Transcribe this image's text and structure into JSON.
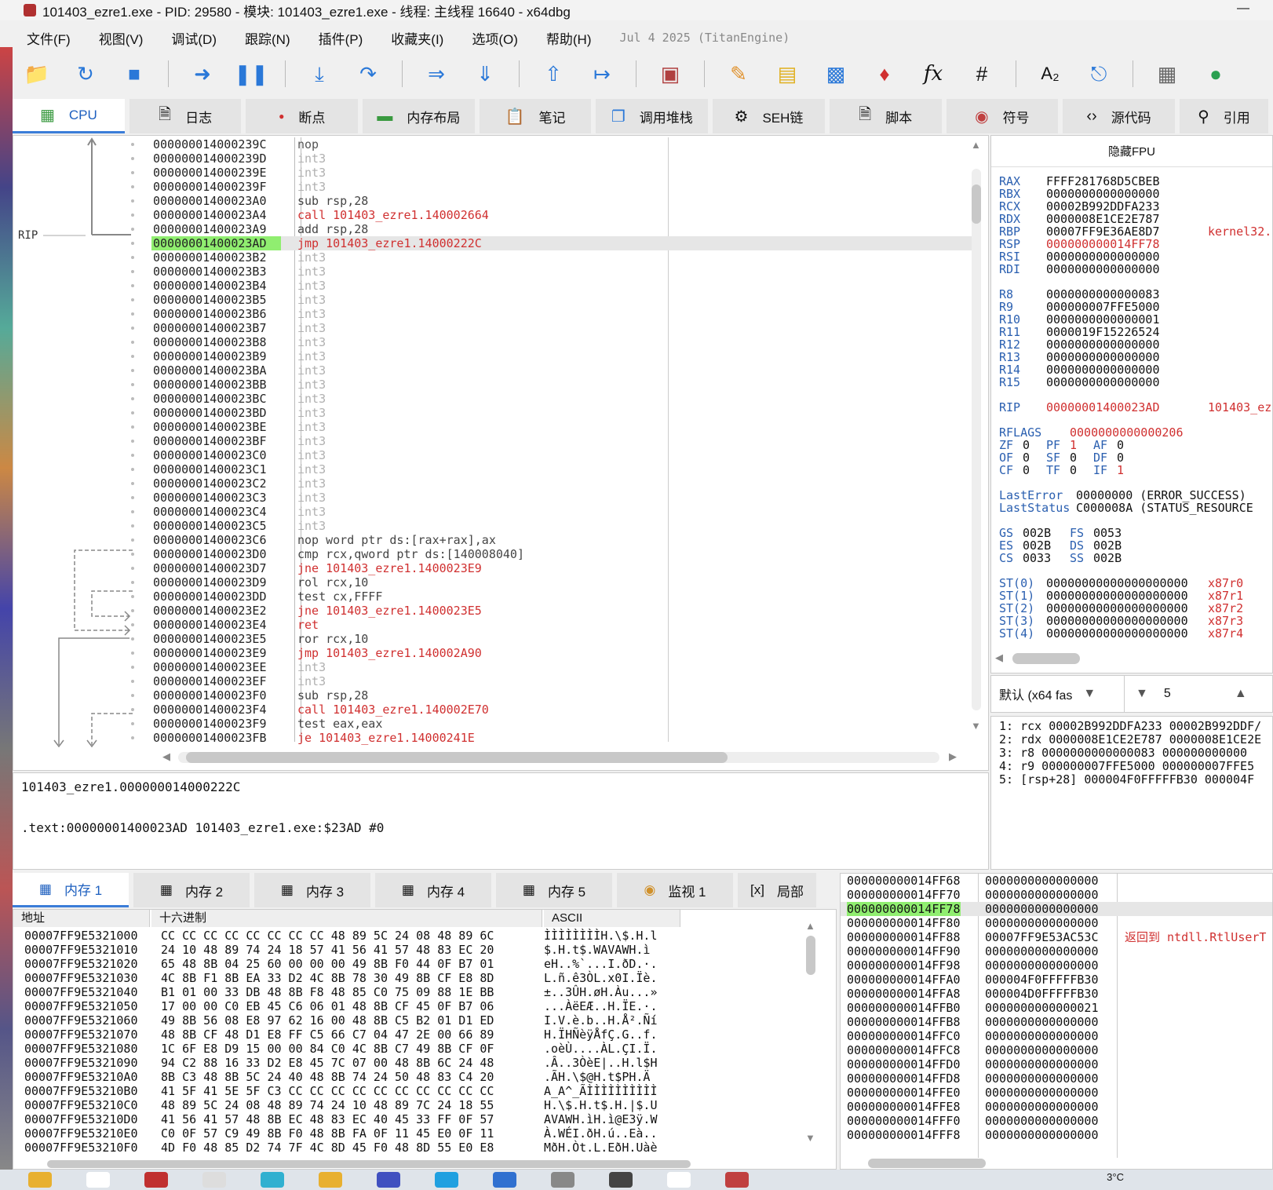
{
  "window": {
    "title": "101403_ezre1.exe - PID: 29580 - 模块: 101403_ezre1.exe - 线程: 主线程 16640 - x64dbg",
    "minimize": "—"
  },
  "menu": {
    "items": [
      "文件(F)",
      "视图(V)",
      "调试(D)",
      "跟踪(N)",
      "插件(P)",
      "收藏夹(I)",
      "选项(O)",
      "帮助(H)"
    ],
    "date": "Jul 4 2025 (TitanEngine)"
  },
  "toolbar": {
    "icons": [
      "open-icon",
      "restart-icon",
      "stop-icon",
      "run-icon",
      "pause-icon",
      "step-into-icon",
      "step-over-icon",
      "trace-into-icon",
      "trace-over-icon",
      "run-to-user-icon",
      "execute-till-return-icon",
      "script-icon",
      "patch-icon",
      "comment-icon",
      "label-icon",
      "bookmark-icon",
      "function-icon",
      "hash-icon",
      "font-icon",
      "find-icon",
      "calculator-icon",
      "globe-icon"
    ],
    "fx": "fx",
    "hash": "#",
    "az": "A₂"
  },
  "tabs": [
    {
      "label": "CPU"
    },
    {
      "label": "日志"
    },
    {
      "label": "断点"
    },
    {
      "label": "内存布局"
    },
    {
      "label": "笔记"
    },
    {
      "label": "调用堆栈"
    },
    {
      "label": "SEH链"
    },
    {
      "label": "脚本"
    },
    {
      "label": "符号"
    },
    {
      "label": "源代码"
    },
    {
      "label": "引用"
    }
  ],
  "disasm": {
    "rip_label": "RIP",
    "rows": [
      {
        "addr": "000000014000239C",
        "ins": "nop",
        "cls": "c-nop"
      },
      {
        "addr": "000000014000239D",
        "ins": "int3",
        "cls": "c-int"
      },
      {
        "addr": "000000014000239E",
        "ins": "int3",
        "cls": "c-int"
      },
      {
        "addr": "000000014000239F",
        "ins": "int3",
        "cls": "c-int"
      },
      {
        "addr": "00000001400023A0",
        "ins": "sub rsp,28",
        "cls": "c-op"
      },
      {
        "addr": "00000001400023A4",
        "ins": "call 101403_ezre1.140002664",
        "cls": "c-call"
      },
      {
        "addr": "00000001400023A9",
        "ins": "add rsp,28",
        "cls": "c-op"
      },
      {
        "addr": "00000001400023AD",
        "ins": "jmp 101403_ezre1.14000222C",
        "cls": "c-jmp",
        "rip": true
      },
      {
        "addr": "00000001400023B2",
        "ins": "int3",
        "cls": "c-int"
      },
      {
        "addr": "00000001400023B3",
        "ins": "int3",
        "cls": "c-int"
      },
      {
        "addr": "00000001400023B4",
        "ins": "int3",
        "cls": "c-int"
      },
      {
        "addr": "00000001400023B5",
        "ins": "int3",
        "cls": "c-int"
      },
      {
        "addr": "00000001400023B6",
        "ins": "int3",
        "cls": "c-int"
      },
      {
        "addr": "00000001400023B7",
        "ins": "int3",
        "cls": "c-int"
      },
      {
        "addr": "00000001400023B8",
        "ins": "int3",
        "cls": "c-int"
      },
      {
        "addr": "00000001400023B9",
        "ins": "int3",
        "cls": "c-int"
      },
      {
        "addr": "00000001400023BA",
        "ins": "int3",
        "cls": "c-int"
      },
      {
        "addr": "00000001400023BB",
        "ins": "int3",
        "cls": "c-int"
      },
      {
        "addr": "00000001400023BC",
        "ins": "int3",
        "cls": "c-int"
      },
      {
        "addr": "00000001400023BD",
        "ins": "int3",
        "cls": "c-int"
      },
      {
        "addr": "00000001400023BE",
        "ins": "int3",
        "cls": "c-int"
      },
      {
        "addr": "00000001400023BF",
        "ins": "int3",
        "cls": "c-int"
      },
      {
        "addr": "00000001400023C0",
        "ins": "int3",
        "cls": "c-int"
      },
      {
        "addr": "00000001400023C1",
        "ins": "int3",
        "cls": "c-int"
      },
      {
        "addr": "00000001400023C2",
        "ins": "int3",
        "cls": "c-int"
      },
      {
        "addr": "00000001400023C3",
        "ins": "int3",
        "cls": "c-int"
      },
      {
        "addr": "00000001400023C4",
        "ins": "int3",
        "cls": "c-int"
      },
      {
        "addr": "00000001400023C5",
        "ins": "int3",
        "cls": "c-int"
      },
      {
        "addr": "00000001400023C6",
        "ins": "nop word ptr ds:[rax+rax],ax",
        "cls": "c-op"
      },
      {
        "addr": "00000001400023D0",
        "ins": "cmp rcx,qword ptr ds:[140008040]",
        "cls": "c-op"
      },
      {
        "addr": "00000001400023D7",
        "ins": "jne 101403_ezre1.1400023E9",
        "cls": "c-jmp"
      },
      {
        "addr": "00000001400023D9",
        "ins": "rol rcx,10",
        "cls": "c-op"
      },
      {
        "addr": "00000001400023DD",
        "ins": "test cx,FFFF",
        "cls": "c-op"
      },
      {
        "addr": "00000001400023E2",
        "ins": "jne 101403_ezre1.1400023E5",
        "cls": "c-jmp"
      },
      {
        "addr": "00000001400023E4",
        "ins": "ret",
        "cls": "c-ret"
      },
      {
        "addr": "00000001400023E5",
        "ins": "ror rcx,10",
        "cls": "c-op"
      },
      {
        "addr": "00000001400023E9",
        "ins": "jmp 101403_ezre1.140002A90",
        "cls": "c-jmp"
      },
      {
        "addr": "00000001400023EE",
        "ins": "int3",
        "cls": "c-int"
      },
      {
        "addr": "00000001400023EF",
        "ins": "int3",
        "cls": "c-int"
      },
      {
        "addr": "00000001400023F0",
        "ins": "sub rsp,28",
        "cls": "c-op"
      },
      {
        "addr": "00000001400023F4",
        "ins": "call 101403_ezre1.140002E70",
        "cls": "c-call"
      },
      {
        "addr": "00000001400023F9",
        "ins": "test eax,eax",
        "cls": "c-op"
      },
      {
        "addr": "00000001400023FB",
        "ins": "je 101403_ezre1.14000241E",
        "cls": "c-jmp"
      }
    ]
  },
  "info": {
    "line1": "101403_ezre1.000000014000222C",
    "line2": ".text:00000001400023AD 101403_ezre1.exe:$23AD #0"
  },
  "registers": {
    "header": "隐藏FPU",
    "rows": [
      {
        "n": "RAX",
        "v": "FFFF281768D5CBEB"
      },
      {
        "n": "RBX",
        "v": "0000000000000000"
      },
      {
        "n": "RCX",
        "v": "00002B992DDFA233"
      },
      {
        "n": "RDX",
        "v": "0000008E1CE2E787"
      },
      {
        "n": "RBP",
        "v": "00007FF9E36AE8D7",
        "c": "kernel32."
      },
      {
        "n": "RSP",
        "v": "000000000014FF78",
        "red": true
      },
      {
        "n": "RSI",
        "v": "0000000000000000"
      },
      {
        "n": "RDI",
        "v": "0000000000000000"
      },
      {
        "n": "",
        "v": ""
      },
      {
        "n": "R8",
        "v": "0000000000000083"
      },
      {
        "n": "R9",
        "v": "000000007FFE5000"
      },
      {
        "n": "R10",
        "v": "0000000000000001"
      },
      {
        "n": "R11",
        "v": "0000019F15226524"
      },
      {
        "n": "R12",
        "v": "0000000000000000"
      },
      {
        "n": "R13",
        "v": "0000000000000000"
      },
      {
        "n": "R14",
        "v": "0000000000000000"
      },
      {
        "n": "R15",
        "v": "0000000000000000"
      },
      {
        "n": "",
        "v": ""
      },
      {
        "n": "RIP",
        "v": "00000001400023AD",
        "red": true,
        "c": "101403_ez"
      },
      {
        "n": "",
        "v": ""
      }
    ],
    "rflags_label": "RFLAGS",
    "rflags": "0000000000000206",
    "flags": [
      [
        "ZF",
        "0",
        "PF",
        "1",
        "AF",
        "0"
      ],
      [
        "OF",
        "0",
        "SF",
        "0",
        "DF",
        "0"
      ],
      [
        "CF",
        "0",
        "TF",
        "0",
        "IF",
        "1"
      ]
    ],
    "last": [
      [
        "LastError",
        "00000000 (ERROR_SUCCESS)"
      ],
      [
        "LastStatus",
        "C000008A (STATUS_RESOURCE"
      ]
    ],
    "seg": [
      [
        "GS",
        "002B",
        "FS",
        "0053"
      ],
      [
        "ES",
        "002B",
        "DS",
        "002B"
      ],
      [
        "CS",
        "0033",
        "SS",
        "002B"
      ]
    ],
    "st": [
      [
        "ST(0)",
        "00000000000000000000",
        "x87r0"
      ],
      [
        "ST(1)",
        "00000000000000000000",
        "x87r1"
      ],
      [
        "ST(2)",
        "00000000000000000000",
        "x87r2"
      ],
      [
        "ST(3)",
        "00000000000000000000",
        "x87r3"
      ],
      [
        "ST(4)",
        "00000000000000000000",
        "x87r4"
      ]
    ]
  },
  "callconv": {
    "selected": "默认 (x64 fas",
    "count": "5"
  },
  "args": [
    "1: rcx 00002B992DDFA233 00002B992DDF/",
    "2: rdx 0000008E1CE2E787 0000008E1CE2E",
    "3: r8 0000000000000083 000000000000",
    "4: r9 000000007FFE5000 000000007FFE5",
    "5: [rsp+28] 000004F0FFFFFB30 000004F"
  ],
  "memtabs": [
    {
      "label": "内存 1"
    },
    {
      "label": "内存 2"
    },
    {
      "label": "内存 3"
    },
    {
      "label": "内存 4"
    },
    {
      "label": "内存 5"
    },
    {
      "label": "监视 1"
    },
    {
      "label": "局部"
    }
  ],
  "dump": {
    "hdr_addr": "地址",
    "hdr_hex": "十六进制",
    "hdr_ascii": "ASCII",
    "rows": [
      {
        "a": "00007FF9E5321000",
        "h": "CC CC CC CC CC CC CC CC 48 89 5C 24 08 48 89 6C",
        "s": "ÌÌÌÌÌÌÌÌH.\\$.H.l"
      },
      {
        "a": "00007FF9E5321010",
        "h": "24 10 48 89 74 24 18 57 41 56 41 57 48 83 EC 20",
        "s": "$.H.t$.WAVAWH.ì "
      },
      {
        "a": "00007FF9E5321020",
        "h": "65 48 8B 04 25 60 00 00 00 49 8B F0 44 0F B7 01",
        "s": "eH..%`...I.ðD.·."
      },
      {
        "a": "00007FF9E5321030",
        "h": "4C 8B F1 8B EA 33 D2 4C 8B 78 30 49 8B CF E8 8D",
        "s": "L.ñ.ê3ÒL.x0I.Ïè."
      },
      {
        "a": "00007FF9E5321040",
        "h": "B1 01 00 33 DB 48 8B F8 48 85 C0 75 09 88 1E BB",
        "s": "±..3ÛH.øH.Àu...»"
      },
      {
        "a": "00007FF9E5321050",
        "h": "17 00 00 C0 EB 45 C6 06 01 48 8B CF 45 0F B7 06",
        "s": "...ÀëEÆ..H.ÏE.·."
      },
      {
        "a": "00007FF9E5321060",
        "h": "49 8B 56 08 E8 97 62 16 00 48 8B C5 B2 01 D1 ED",
        "s": "I.V.è.b..H.Å².Ñí"
      },
      {
        "a": "00007FF9E5321070",
        "h": "48 8B CF 48 D1 E8 FF C5 66 C7 04 47 2E 00 66 89",
        "s": "H.ÏHÑèÿÅfÇ.G..f."
      },
      {
        "a": "00007FF9E5321080",
        "h": "1C 6F E8 D9 15 00 00 84 C0 4C 8B C7 49 8B CF 0F",
        "s": ".oèÙ....ÀL.ÇI.Ï."
      },
      {
        "a": "00007FF9E5321090",
        "h": "94 C2 88 16 33 D2 E8 45 7C 07 00 48 8B 6C 24 48",
        "s": ".Â..3ÒèE|..H.l$H"
      },
      {
        "a": "00007FF9E53210A0",
        "h": "8B C3 48 8B 5C 24 40 48 8B 74 24 50 48 83 C4 20",
        "s": ".ÃH.\\$@H.t$PH.Ä "
      },
      {
        "a": "00007FF9E53210B0",
        "h": "41 5F 41 5E 5F C3 CC CC CC CC CC CC CC CC CC CC",
        "s": "A_A^_ÃÌÌÌÌÌÌÌÌÌÌ"
      },
      {
        "a": "00007FF9E53210C0",
        "h": "48 89 5C 24 08 48 89 74 24 10 48 89 7C 24 18 55",
        "s": "H.\\$.H.t$.H.|$.U"
      },
      {
        "a": "00007FF9E53210D0",
        "h": "41 56 41 57 48 8B EC 48 83 EC 40 45 33 FF 0F 57",
        "s": "AVAWH.ìH.ì@E3ÿ.W"
      },
      {
        "a": "00007FF9E53210E0",
        "h": "C0 0F 57 C9 49 8B F0 48 8B FA 0F 11 45 E0 0F 11",
        "s": "À.WÉI.ðH.ú..Eà.."
      },
      {
        "a": "00007FF9E53210F0",
        "h": "4D F0 48 85 D2 74 7F 4C 8D 45 F0 48 8D 55 E0 E8",
        "s": "MðH.Òt.L.EðH.Uàè"
      }
    ]
  },
  "stack": {
    "rows": [
      {
        "a": "000000000014FF68",
        "v": "0000000000000000"
      },
      {
        "a": "000000000014FF70",
        "v": "0000000000000000"
      },
      {
        "a": "000000000014FF78",
        "v": "0000000000000000",
        "sel": true
      },
      {
        "a": "000000000014FF80",
        "v": "0000000000000000"
      },
      {
        "a": "000000000014FF88",
        "v": "00007FF9E53AC53C",
        "c": "返回到 ntdll.RtlUserT"
      },
      {
        "a": "000000000014FF90",
        "v": "0000000000000000"
      },
      {
        "a": "000000000014FF98",
        "v": "0000000000000000"
      },
      {
        "a": "000000000014FFA0",
        "v": "000004F0FFFFFB30"
      },
      {
        "a": "000000000014FFA8",
        "v": "000004D0FFFFFB30"
      },
      {
        "a": "000000000014FFB0",
        "v": "0000000000000021"
      },
      {
        "a": "000000000014FFB8",
        "v": "0000000000000000"
      },
      {
        "a": "000000000014FFC0",
        "v": "0000000000000000"
      },
      {
        "a": "000000000014FFC8",
        "v": "0000000000000000"
      },
      {
        "a": "000000000014FFD0",
        "v": "0000000000000000"
      },
      {
        "a": "000000000014FFD8",
        "v": "0000000000000000"
      },
      {
        "a": "000000000014FFE0",
        "v": "0000000000000000"
      },
      {
        "a": "000000000014FFE8",
        "v": "0000000000000000"
      },
      {
        "a": "000000000014FFF0",
        "v": "0000000000000000"
      },
      {
        "a": "000000000014FFF8",
        "v": "0000000000000000"
      }
    ]
  },
  "taskbar": {
    "temp": "3°C"
  },
  "colors": {
    "accent": "#3b7dd8",
    "rip": "#90ee70",
    "red": "#d03030",
    "reg_name": "#2a5fb0"
  }
}
